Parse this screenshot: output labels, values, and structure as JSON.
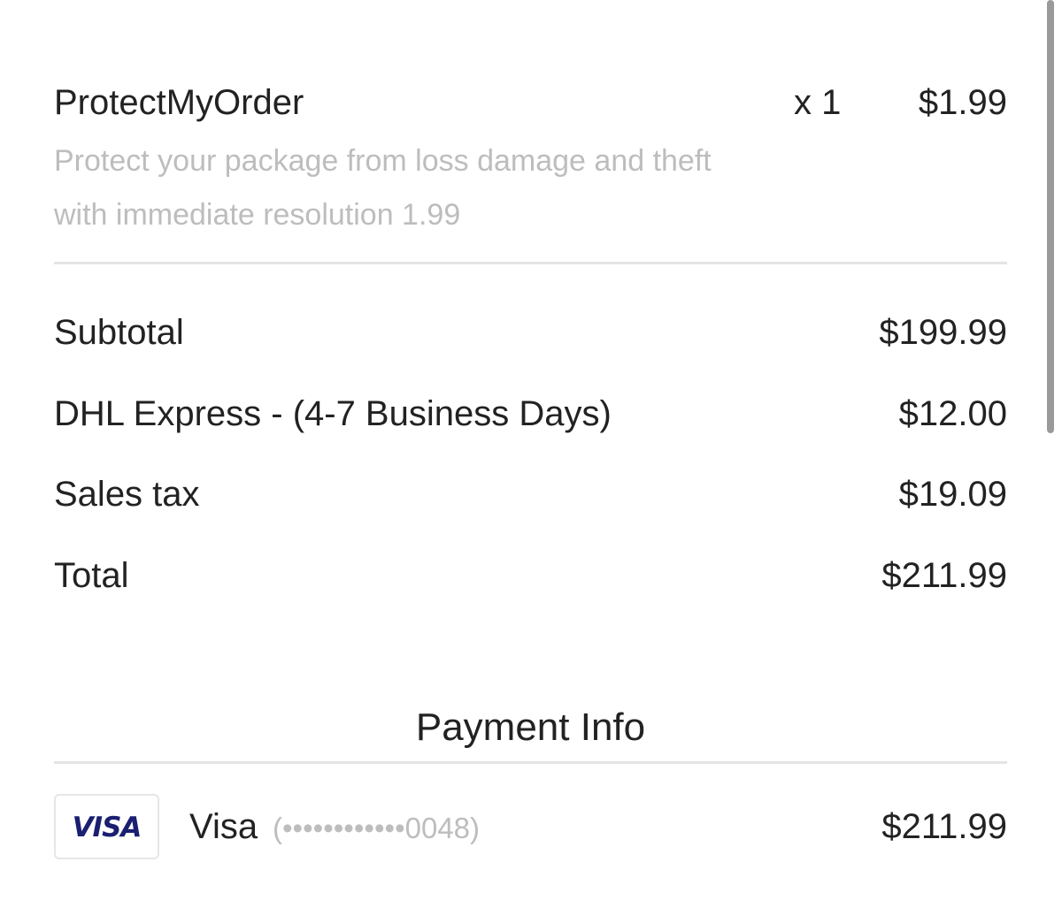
{
  "line_item": {
    "name": "ProtectMyOrder",
    "quantity": "x 1",
    "price": "$1.99",
    "description": "Protect your package from loss damage and theft with immediate resolution 1.99"
  },
  "summary": {
    "subtotal_label": "Subtotal",
    "subtotal_value": "$199.99",
    "shipping_label": "DHL Express - (4-7 Business Days)",
    "shipping_value": "$12.00",
    "tax_label": "Sales tax",
    "tax_value": "$19.09",
    "total_label": "Total",
    "total_value": "$211.99"
  },
  "payment": {
    "title": "Payment Info",
    "card_logo_text": "VISA",
    "card_name": "Visa",
    "card_number": "(••••••••••••0048)",
    "amount": "$211.99",
    "brand_color": "#1a1f71"
  }
}
